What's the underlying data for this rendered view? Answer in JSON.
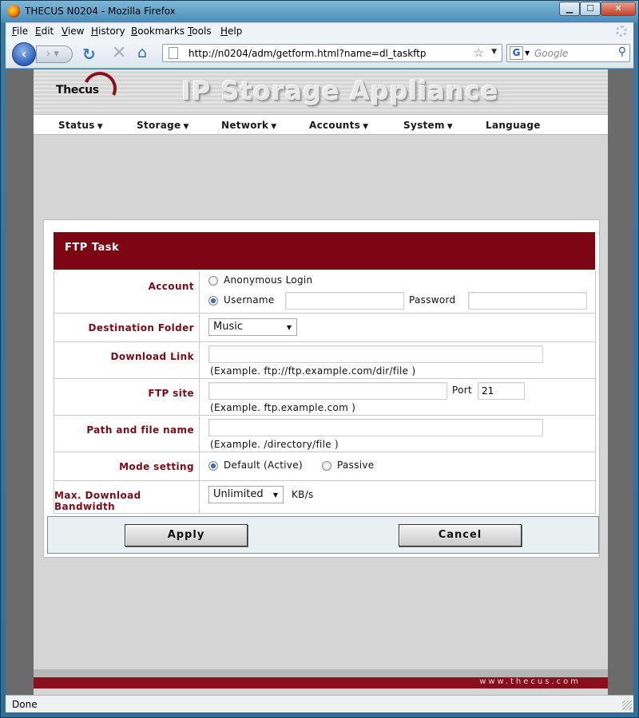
{
  "window": {
    "title": "THECUS N0204 - Mozilla Firefox"
  },
  "menubar": {
    "items": [
      {
        "key": "F",
        "rest": "ile"
      },
      {
        "key": "E",
        "rest": "dit"
      },
      {
        "key": "V",
        "rest": "iew"
      },
      {
        "key": "H",
        "rest": "istory"
      },
      {
        "key": "B",
        "rest": "ookmarks"
      },
      {
        "key": "T",
        "rest": "ools"
      },
      {
        "key": "H",
        "rest": "elp"
      }
    ]
  },
  "navbar": {
    "url": "http://n0204/adm/getform.html?name=dl_taskftp",
    "search_placeholder": "Google",
    "search_engine_letter": "G"
  },
  "banner": {
    "logo": "Thecus",
    "title": "IP Storage Appliance"
  },
  "nav": {
    "items": [
      {
        "label": "Status",
        "caret": "▼"
      },
      {
        "label": "Storage",
        "caret": "▼"
      },
      {
        "label": "Network",
        "caret": "▼"
      },
      {
        "label": "Accounts",
        "caret": "▼"
      },
      {
        "label": "System",
        "caret": "▼"
      },
      {
        "label": "Language",
        "caret": ""
      }
    ]
  },
  "form": {
    "title": "FTP Task",
    "account": {
      "label": "Account",
      "option_anonymous": "Anonymous Login",
      "option_username": "Username",
      "password_label": "Password",
      "selected": "Username",
      "username_value": "",
      "password_value": ""
    },
    "destination": {
      "label": "Destination Folder",
      "value": "Music"
    },
    "download_link": {
      "label": "Download Link",
      "value": "",
      "hint": "(Example. ftp://ftp.example.com/dir/file )"
    },
    "ftp_site": {
      "label": "FTP site",
      "value": "",
      "port_label": "Port",
      "port_value": "21",
      "hint": "(Example. ftp.example.com )"
    },
    "path": {
      "label": "Path and file name",
      "value": "",
      "hint": "(Example. /directory/file )"
    },
    "mode": {
      "label": "Mode setting",
      "option_default": "Default (Active)",
      "option_passive": "Passive",
      "selected": "Default (Active)"
    },
    "bandwidth": {
      "label": "Max. Download Bandwidth",
      "value": "Unlimited",
      "unit": "KB/s"
    },
    "apply_label": "Apply",
    "cancel_label": "Cancel"
  },
  "footer": {
    "text": "www.thecus.com"
  },
  "status": {
    "text": "Done"
  }
}
